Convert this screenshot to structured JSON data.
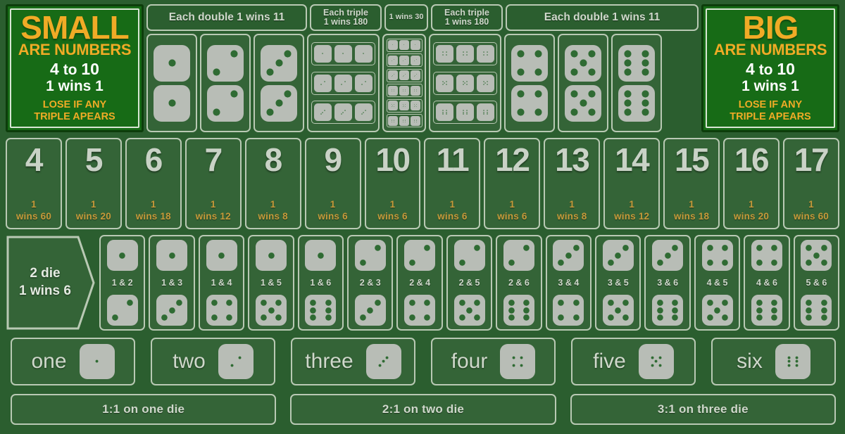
{
  "board": {
    "felt_color": "#2b5e2f",
    "line_color": "#b9c9b4",
    "gold_color": "#f0ab26",
    "pip_color": "#2f6b33",
    "die_color": "#b8bdb6"
  },
  "small_box": {
    "title": "SMALL",
    "subtitle": "ARE NUMBERS",
    "range_prefix": "4",
    "range_mid": "to",
    "range_suffix": "10",
    "win": "1 wins 1",
    "lose_line1": "LOSE IF ANY",
    "lose_line2": "TRIPLE APEARS"
  },
  "big_box": {
    "title": "BIG",
    "subtitle": "ARE NUMBERS",
    "range_prefix": "4",
    "range_mid": "to",
    "range_suffix": "10",
    "win": "1 wins 1",
    "lose_line1": "LOSE IF ANY",
    "lose_line2": "TRIPLE APEARS"
  },
  "headers": {
    "double_left": "Each double 1 wins 11",
    "triple_left_l1": "Each triple",
    "triple_left_l2": "1 wins 180",
    "any_triple": "1 wins 30",
    "triple_right_l1": "Each triple",
    "triple_right_l2": "1 wins 180",
    "double_right": "Each double 1 wins 11"
  },
  "doubles_left": [
    1,
    2,
    3
  ],
  "doubles_right": [
    4,
    5,
    6
  ],
  "triples_left": [
    1,
    2,
    3
  ],
  "triples_right": [
    4,
    5,
    6
  ],
  "any_triple_faces": [
    1,
    2,
    3,
    4,
    5,
    6
  ],
  "totals": [
    {
      "number": "4",
      "pay_line1": "1",
      "pay_line2": "wins 60"
    },
    {
      "number": "5",
      "pay_line1": "1",
      "pay_line2": "wins 20"
    },
    {
      "number": "6",
      "pay_line1": "1",
      "pay_line2": "wins 18"
    },
    {
      "number": "7",
      "pay_line1": "1",
      "pay_line2": "wins 12"
    },
    {
      "number": "8",
      "pay_line1": "1",
      "pay_line2": "wins 8"
    },
    {
      "number": "9",
      "pay_line1": "1",
      "pay_line2": "wins 6"
    },
    {
      "number": "10",
      "pay_line1": "1",
      "pay_line2": "wins 6"
    },
    {
      "number": "11",
      "pay_line1": "1",
      "pay_line2": "wins 6"
    },
    {
      "number": "12",
      "pay_line1": "1",
      "pay_line2": "wins 6"
    },
    {
      "number": "13",
      "pay_line1": "1",
      "pay_line2": "wins 8"
    },
    {
      "number": "14",
      "pay_line1": "1",
      "pay_line2": "wins 12"
    },
    {
      "number": "15",
      "pay_line1": "1",
      "pay_line2": "wins 18"
    },
    {
      "number": "16",
      "pay_line1": "1",
      "pay_line2": "wins 20"
    },
    {
      "number": "17",
      "pay_line1": "1",
      "pay_line2": "wins 60"
    }
  ],
  "two_die": {
    "line1": "2 die",
    "line2": "1 wins 6"
  },
  "combos": [
    {
      "label": "1 & 2",
      "a": 1,
      "b": 2
    },
    {
      "label": "1 & 3",
      "a": 1,
      "b": 3
    },
    {
      "label": "1 & 4",
      "a": 1,
      "b": 4
    },
    {
      "label": "1 & 5",
      "a": 1,
      "b": 5
    },
    {
      "label": "1 & 6",
      "a": 1,
      "b": 6
    },
    {
      "label": "2 & 3",
      "a": 2,
      "b": 3
    },
    {
      "label": "2 & 4",
      "a": 2,
      "b": 4
    },
    {
      "label": "2 & 5",
      "a": 2,
      "b": 5
    },
    {
      "label": "2 & 6",
      "a": 2,
      "b": 6
    },
    {
      "label": "3 & 4",
      "a": 3,
      "b": 4
    },
    {
      "label": "3 & 5",
      "a": 3,
      "b": 5
    },
    {
      "label": "3 & 6",
      "a": 3,
      "b": 6
    },
    {
      "label": "4 & 5",
      "a": 4,
      "b": 5
    },
    {
      "label": "4 & 6",
      "a": 4,
      "b": 6
    },
    {
      "label": "5 & 6",
      "a": 5,
      "b": 6
    }
  ],
  "singles": [
    {
      "label": "one",
      "face": 1
    },
    {
      "label": "two",
      "face": 2
    },
    {
      "label": "three",
      "face": 3
    },
    {
      "label": "four",
      "face": 4
    },
    {
      "label": "five",
      "face": 5
    },
    {
      "label": "six",
      "face": 6
    }
  ],
  "odds_bars": [
    {
      "label": "1:1 on one die"
    },
    {
      "label": "2:1 on two die"
    },
    {
      "label": "3:1 on three die"
    }
  ]
}
